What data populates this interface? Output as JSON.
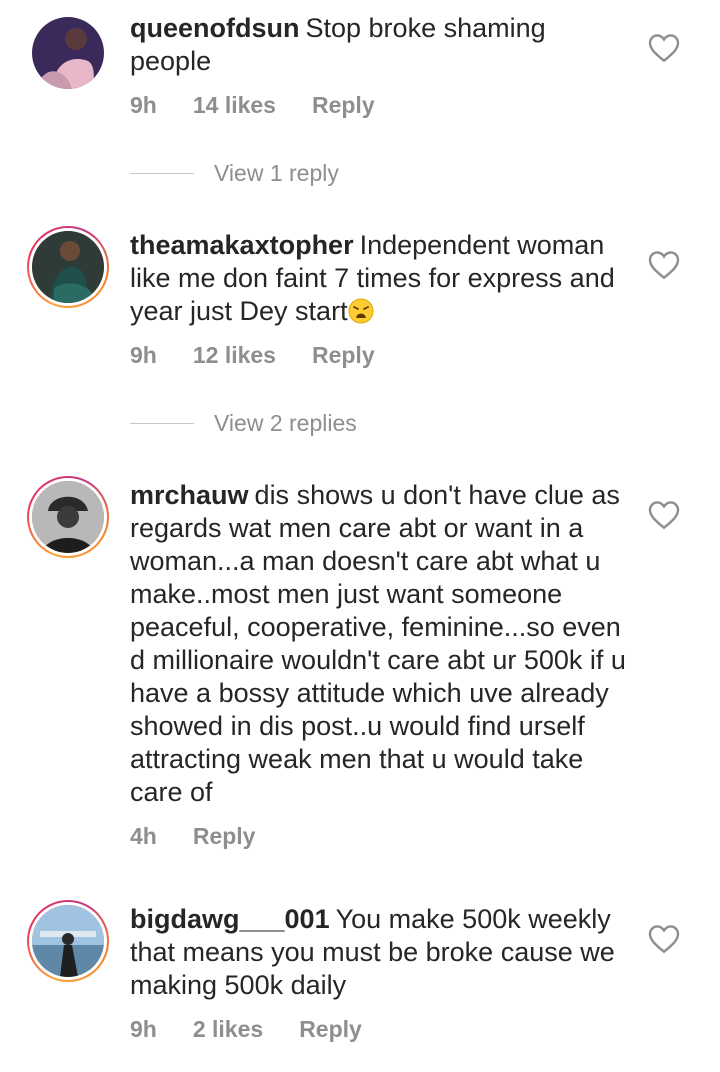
{
  "comments": [
    {
      "username": "queenofdsun",
      "text": "Stop broke shaming people",
      "time": "9h",
      "likes": "14 likes",
      "reply": "Reply",
      "view_replies": "View 1 reply"
    },
    {
      "username": "theamakaxtopher",
      "text": "Independent woman like me don faint 7 times for express and year just Dey start",
      "emoji": "weary-face",
      "time": "9h",
      "likes": "12 likes",
      "reply": "Reply",
      "view_replies": "View 2 replies"
    },
    {
      "username": "mrchauw",
      "text": "dis shows u don't have clue as regards wat men care abt or want in a woman...a man doesn't care abt what u make..most men just want someone peaceful, cooperative, feminine...so even d millionaire wouldn't care abt ur 500k if u have a bossy attitude which uve already showed in dis post..u would find urself attracting weak men that u would take care of",
      "time": "4h",
      "reply": "Reply"
    },
    {
      "username": "bigdawg___001",
      "text": "You make 500k weekly that means you must be broke cause we making 500k daily",
      "time": "9h",
      "likes": "2 likes",
      "reply": "Reply"
    }
  ],
  "icons": {
    "like": "heart-outline-icon"
  },
  "colors": {
    "text": "#262626",
    "muted": "#8e8e8e",
    "story_ring": "#e1306c"
  }
}
